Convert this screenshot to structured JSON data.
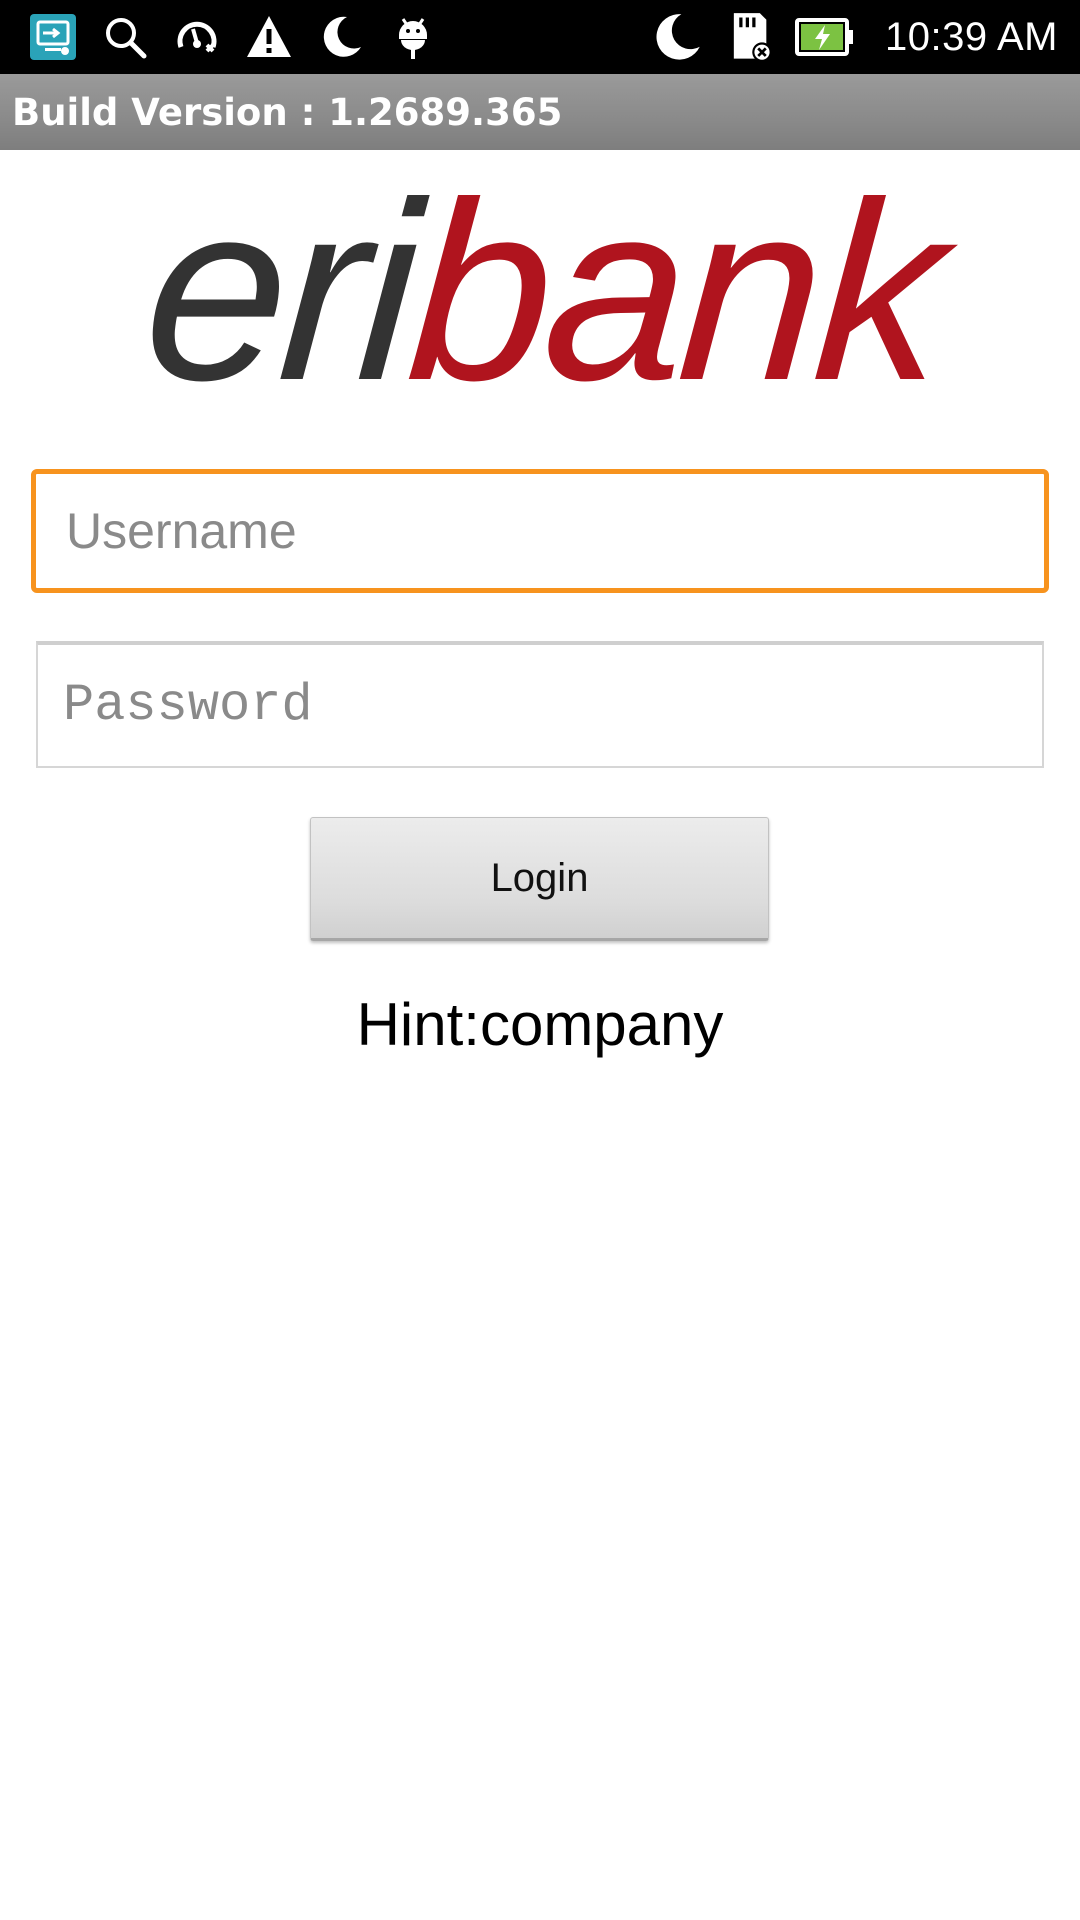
{
  "status_bar": {
    "time": "10:39 AM",
    "left_icons": [
      "screen-mirror-icon",
      "search-icon",
      "speedometer-icon",
      "warning-icon",
      "moon-icon",
      "android-debug-icon"
    ],
    "right_icons": [
      "moon-icon",
      "sd-card-error-icon",
      "battery-charging-icon"
    ]
  },
  "build_bar": {
    "text": "Build Version : 1.2689.365"
  },
  "logo": {
    "part1": "eri",
    "part2": "bank",
    "color_part1": "#333333",
    "color_part2": "#b0141e"
  },
  "form": {
    "username_placeholder": "Username",
    "password_placeholder": "Password",
    "login_label": "Login",
    "hint": "Hint:company"
  },
  "colors": {
    "focus_border": "#f7931e",
    "status_bar_bg": "#000000",
    "build_bar_bg": "#8a8a8a"
  }
}
